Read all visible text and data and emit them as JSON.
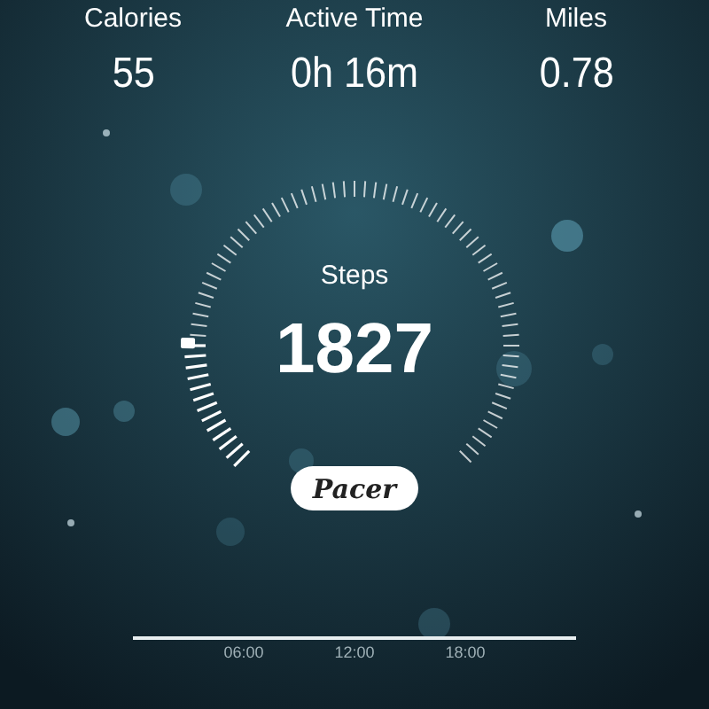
{
  "stats": [
    {
      "label": "Calories",
      "value": "55"
    },
    {
      "label": "Active Time",
      "value": "0h 16m"
    },
    {
      "label": "Miles",
      "value": "0.78"
    }
  ],
  "steps": {
    "label": "Steps",
    "value": "1827"
  },
  "logo": "Pacer",
  "timeline": {
    "ticks": [
      "06:00",
      "12:00",
      "18:00"
    ]
  }
}
